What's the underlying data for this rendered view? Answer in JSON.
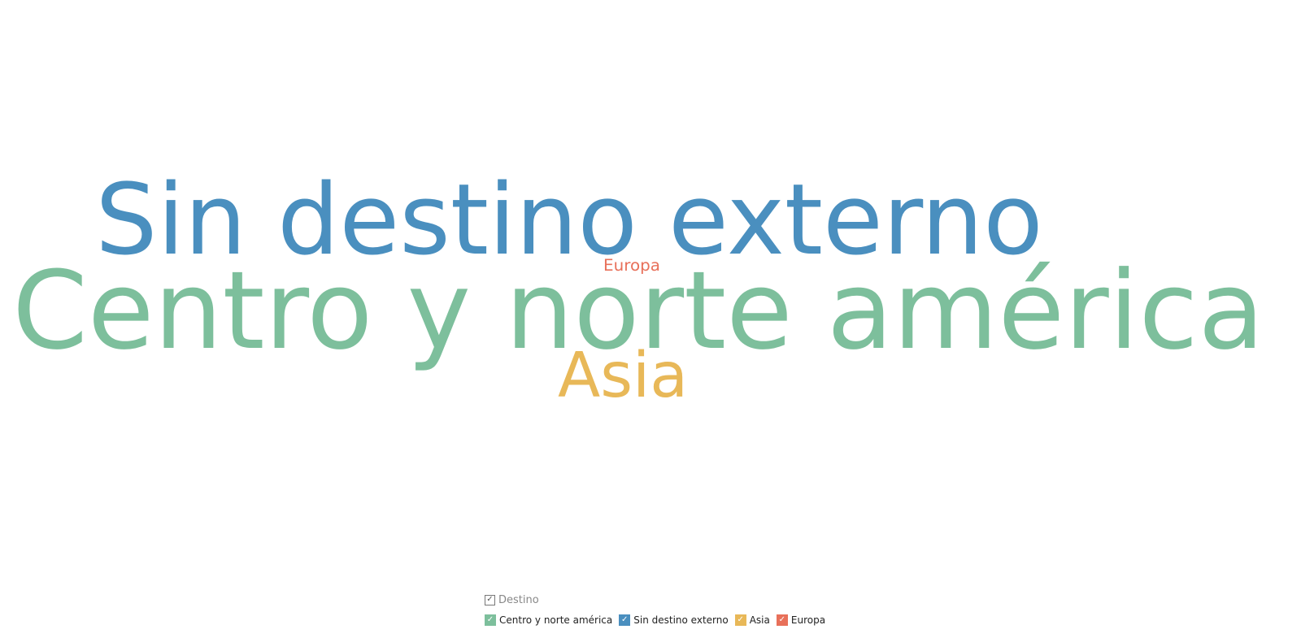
{
  "chart_data": {
    "type": "wordcloud",
    "legend_title": "Destino",
    "legend_placement": "bottom-center",
    "words": [
      {
        "text": "Centro y norte américa",
        "weight": 100,
        "color": "#7dbf9c"
      },
      {
        "text": "Sin destino externo",
        "weight": 88,
        "color": "#4a8fbf"
      },
      {
        "text": "Asia",
        "weight": 58,
        "color": "#e8b858"
      },
      {
        "text": "Europa",
        "weight": 15,
        "color": "#e8705a"
      }
    ]
  },
  "legend": {
    "title": "Destino",
    "checkmark": "✓",
    "items": [
      {
        "label": "Centro y norte américa",
        "color": "#7dbf9c",
        "checked": true
      },
      {
        "label": "Sin destino externo",
        "color": "#4a8fbf",
        "checked": true
      },
      {
        "label": "Asia",
        "color": "#e8b858",
        "checked": true
      },
      {
        "label": "Europa",
        "color": "#e8705a",
        "checked": true
      }
    ]
  }
}
